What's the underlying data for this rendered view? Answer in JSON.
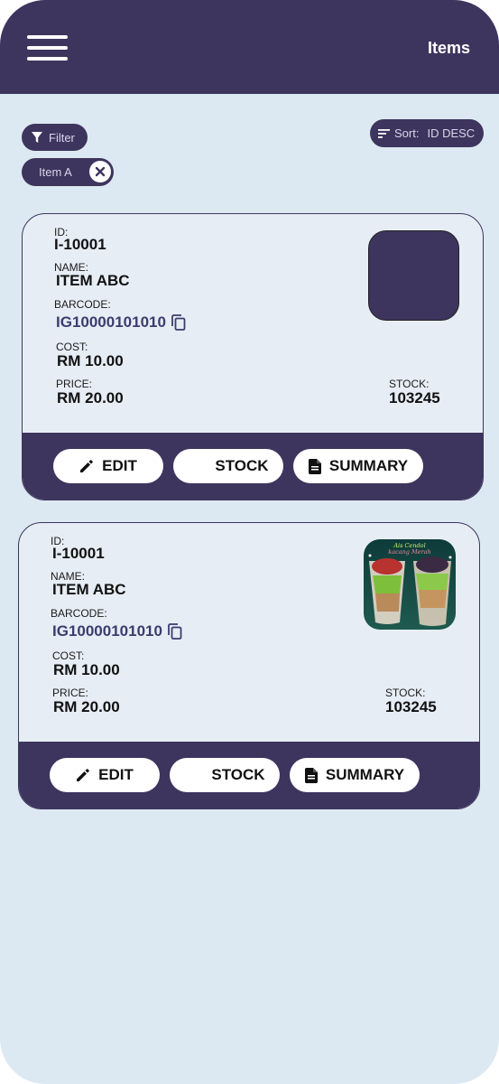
{
  "appbar": {
    "title": "Items"
  },
  "filter": {
    "label": "Filter"
  },
  "sort": {
    "label": "Sort:",
    "value": "ID DESC"
  },
  "active_tags": [
    {
      "label": "Item A"
    }
  ],
  "items": [
    {
      "id_label": "ID:",
      "id": "I-10001",
      "name_label": "NAME:",
      "name": "ITEM ABC",
      "barcode_label": "BARCODE:",
      "barcode": "IG10000101010",
      "cost_label": "COST:",
      "cost": "RM 10.00",
      "price_label": "PRICE:",
      "price": "RM 20.00",
      "stock_label": "STOCK:",
      "stock": "103245",
      "edit_label": "EDIT",
      "stock_button_label": "STOCK",
      "summary_label": "SUMMARY"
    },
    {
      "id_label": "ID:",
      "id": "I-10001",
      "name_label": "NAME:",
      "name": "ITEM ABC",
      "barcode_label": "BARCODE:",
      "barcode": "IG10000101010",
      "cost_label": "COST:",
      "cost": "RM 10.00",
      "price_label": "PRICE:",
      "price": "RM 20.00",
      "stock_label": "STOCK:",
      "stock": "103245",
      "edit_label": "EDIT",
      "stock_button_label": "STOCK",
      "summary_label": "SUMMARY",
      "photo_caption_line1": "Ais Cendol",
      "photo_caption_line2": "kacang Merah"
    }
  ],
  "colors": {
    "primary": "#3d355e",
    "background": "#dde9f2",
    "card": "#e7edf5",
    "barcode": "#3d3b6e"
  }
}
